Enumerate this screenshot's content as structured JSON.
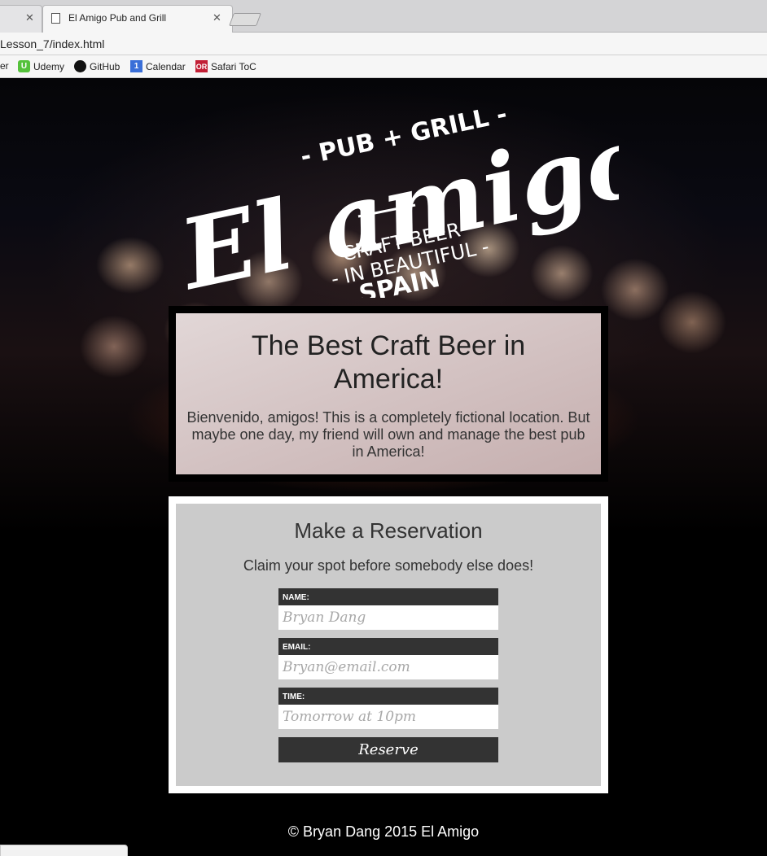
{
  "browser": {
    "tabs": [
      {
        "label": "",
        "active": false
      },
      {
        "label": "El Amigo Pub and Grill",
        "active": true
      }
    ],
    "url": "Lesson_7/index.html",
    "bookmarks": [
      {
        "label": "er",
        "icon": ""
      },
      {
        "label": "Udemy",
        "icon": "udemy-icon"
      },
      {
        "label": "GitHub",
        "icon": "github-icon"
      },
      {
        "label": "Calendar",
        "icon": "calendar-icon"
      },
      {
        "label": "Safari ToC",
        "icon": "safari-toc-icon"
      }
    ]
  },
  "logo": {
    "main": "El amigo",
    "top": "- PUB + GRILL -",
    "line1": "CRAFT BEER",
    "line2": "- IN BEAUTIFUL -",
    "line3": "SPAIN"
  },
  "intro": {
    "heading": "The Best Craft Beer in America!",
    "body": "Bienvenido, amigos! This is a completely fictional location. But maybe one day, my friend will own and manage the best pub in America!"
  },
  "reservation": {
    "heading": "Make a Reservation",
    "subheading": "Claim your spot before somebody else does!",
    "fields": [
      {
        "label": "NAME:",
        "placeholder": "Bryan Dang"
      },
      {
        "label": "EMAIL:",
        "placeholder": "Bryan@email.com"
      },
      {
        "label": "TIME:",
        "placeholder": "Tomorrow at 10pm"
      }
    ],
    "button": "Reserve"
  },
  "footer": "© Bryan Dang 2015 El Amigo",
  "colors": {
    "page_bg": "#000000",
    "form_panel": "#cbcbcb",
    "label_bar": "#333333",
    "button": "#333333"
  }
}
